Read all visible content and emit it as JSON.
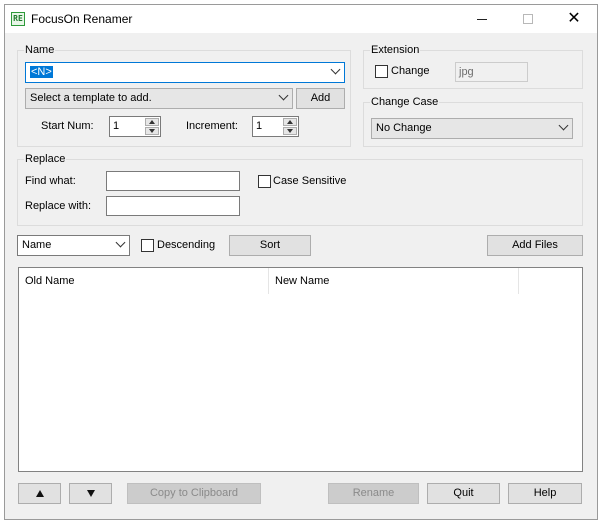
{
  "window": {
    "title": "FocusOn Renamer",
    "icon_text": "RE"
  },
  "name_group": {
    "label": "Name",
    "pattern_value": "<N>",
    "template_placeholder": "Select a template to add.",
    "add_label": "Add",
    "start_num_label": "Start Num:",
    "start_num_value": "1",
    "increment_label": "Increment:",
    "increment_value": "1"
  },
  "extension_group": {
    "label": "Extension",
    "change_label": "Change",
    "change_checked": false,
    "ext_value": "jpg"
  },
  "change_case_group": {
    "label": "Change Case",
    "selected": "No Change"
  },
  "replace_group": {
    "label": "Replace",
    "find_label": "Find what:",
    "find_value": "",
    "case_sensitive_label": "Case Sensitive",
    "case_sensitive_checked": false,
    "replace_label": "Replace with:",
    "replace_value": ""
  },
  "sort_bar": {
    "sort_by": "Name",
    "descending_label": "Descending",
    "descending_checked": false,
    "sort_label": "Sort",
    "add_files_label": "Add Files"
  },
  "file_list": {
    "columns": [
      "Old Name",
      "New Name"
    ],
    "rows": []
  },
  "footer": {
    "copy_label": "Copy to Clipboard",
    "rename_label": "Rename",
    "quit_label": "Quit",
    "help_label": "Help"
  }
}
